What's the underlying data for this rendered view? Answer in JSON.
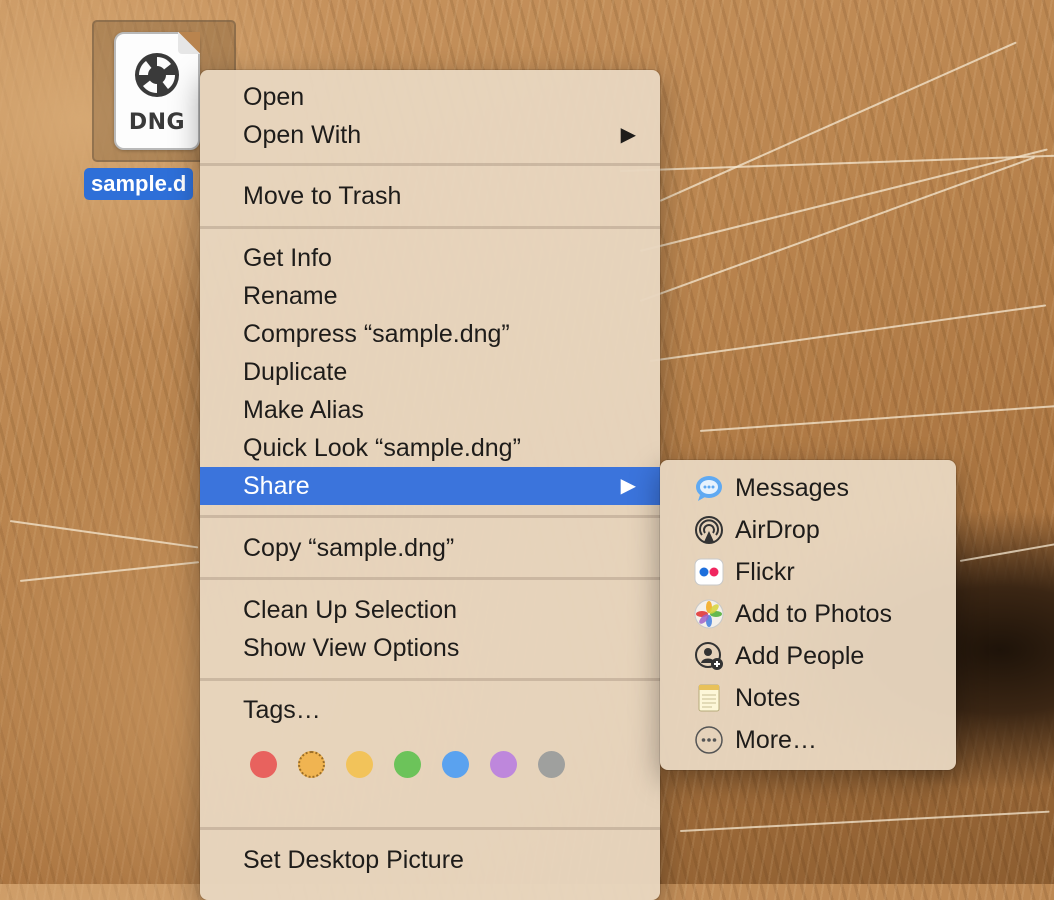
{
  "desktop": {
    "file": {
      "label": "sample.d",
      "extension": "DNG"
    }
  },
  "context_menu": {
    "open": "Open",
    "open_with": "Open With",
    "move_to_trash": "Move to Trash",
    "get_info": "Get Info",
    "rename": "Rename",
    "compress": "Compress “sample.dng”",
    "duplicate": "Duplicate",
    "make_alias": "Make Alias",
    "quick_look": "Quick Look “sample.dng”",
    "share": "Share",
    "copy": "Copy “sample.dng”",
    "clean_up": "Clean Up Selection",
    "show_view_options": "Show View Options",
    "tags": "Tags…",
    "tag_colors": [
      "#e8625e",
      "#f0b451",
      "#f2c35a",
      "#6cc35a",
      "#5aa2ef",
      "#be87dc",
      "#9fa09e"
    ],
    "set_desktop_picture": "Set Desktop Picture",
    "submenu_arrow": "▶"
  },
  "share_menu": {
    "items": [
      {
        "label": "Messages",
        "icon": "messages-icon"
      },
      {
        "label": "AirDrop",
        "icon": "airdrop-icon"
      },
      {
        "label": "Flickr",
        "icon": "flickr-icon"
      },
      {
        "label": "Add to Photos",
        "icon": "photos-icon"
      },
      {
        "label": "Add People",
        "icon": "add-people-icon"
      },
      {
        "label": "Notes",
        "icon": "notes-icon"
      },
      {
        "label": "More…",
        "icon": "more-icon"
      }
    ]
  },
  "colors": {
    "highlight": "#3b74dc",
    "selection": "#2e6fd8",
    "menu_bg": "#e8d6c0"
  }
}
